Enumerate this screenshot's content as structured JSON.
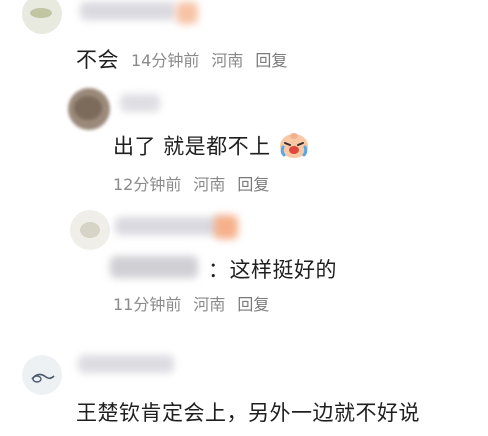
{
  "comments": [
    {
      "text": "不会",
      "time": "14分钟前",
      "location": "河南",
      "reply_label": "回复"
    },
    {
      "text": "出了 就是都不上",
      "emoji": "crying-laughing-face",
      "time": "12分钟前",
      "location": "河南",
      "reply_label": "回复"
    },
    {
      "reply_tail": "：这样挺好的",
      "time": "11分钟前",
      "location": "河南",
      "reply_label": "回复"
    },
    {
      "text": "王楚钦肯定会上，另外一边就不好说"
    }
  ],
  "colors": {
    "meta_text": "#8a8a8a",
    "content_text": "#1f1f1f",
    "background": "#ffffff"
  }
}
